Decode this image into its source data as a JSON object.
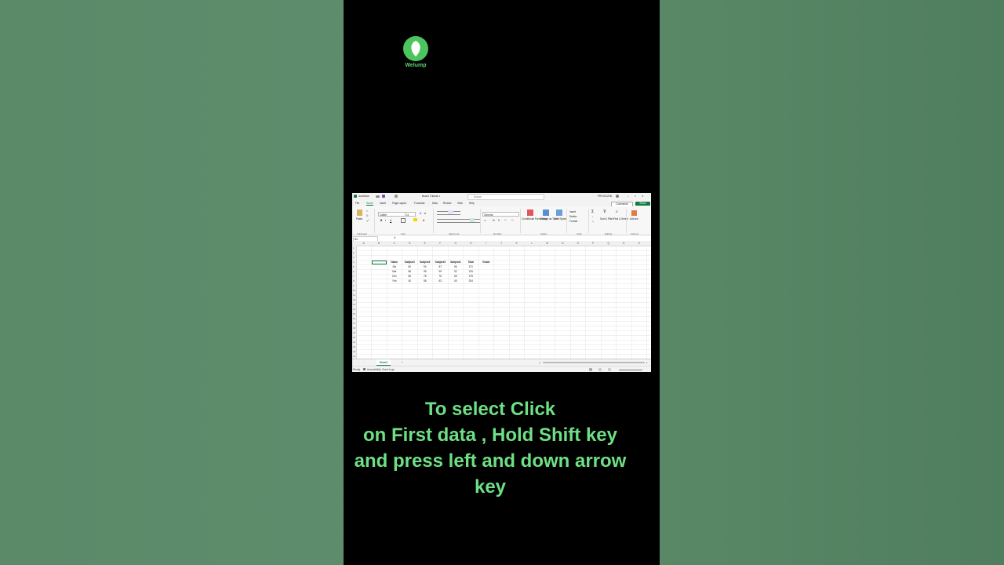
{
  "brand": {
    "name": "Welump",
    "color": "#4cc55e"
  },
  "excel": {
    "title_bar": {
      "autosave": "AutoSave",
      "file_name": "Book1 Tutorial ∨",
      "search_placeholder": "Search",
      "user": "PRIYA EZHIL"
    },
    "menu": [
      "File",
      "Home",
      "Insert",
      "Page Layout",
      "Formulas",
      "Data",
      "Review",
      "View",
      "Help"
    ],
    "comments_label": "Comments",
    "share_label": "Share",
    "ribbon": {
      "paste": "Paste",
      "font_name": "Calibri",
      "font_size": "11",
      "number_format": "General",
      "conditional_formatting": "Conditional Formatting",
      "format_as_table": "Format as Table",
      "cell_styles": "Cell Styles",
      "insert": "Insert",
      "delete": "Delete",
      "format": "Format",
      "sort_filter": "Sort & Filter",
      "find_select": "Find & Select",
      "add_ins": "Add-ins",
      "groups": [
        "Clipboard",
        "Font",
        "Alignment",
        "Number",
        "Styles",
        "Cells",
        "Editing",
        "Add-ins"
      ]
    },
    "name_box": "B4",
    "fx_label": "fx",
    "columns": [
      "A",
      "B",
      "C",
      "D",
      "E",
      "F",
      "G",
      "H",
      "I",
      "J",
      "K",
      "L",
      "M",
      "N",
      "O",
      "P",
      "Q",
      "R",
      "S"
    ],
    "table": {
      "headers": [
        "Name",
        "Subject1",
        "Subject2",
        "Subject3",
        "Subject4",
        "Total",
        "Grade"
      ],
      "rows": [
        [
          "Sia",
          "80",
          "90",
          "87",
          "96",
          "371",
          ""
        ],
        [
          "Mia",
          "86",
          "95",
          "99",
          "92",
          "376",
          ""
        ],
        [
          "Zen",
          "56",
          "78",
          "76",
          "65",
          "275",
          ""
        ],
        [
          "Yun",
          "40",
          "56",
          "63",
          "45",
          "204",
          ""
        ]
      ]
    },
    "sheet_tab": "Sheet1",
    "status": {
      "ready": "Ready",
      "accessibility": "Accessibility: Good to go"
    }
  },
  "caption": {
    "line1": "To select Click",
    "line2": "on First data , Hold Shift key",
    "line3": "and press left and down arrow",
    "line4": "key"
  }
}
